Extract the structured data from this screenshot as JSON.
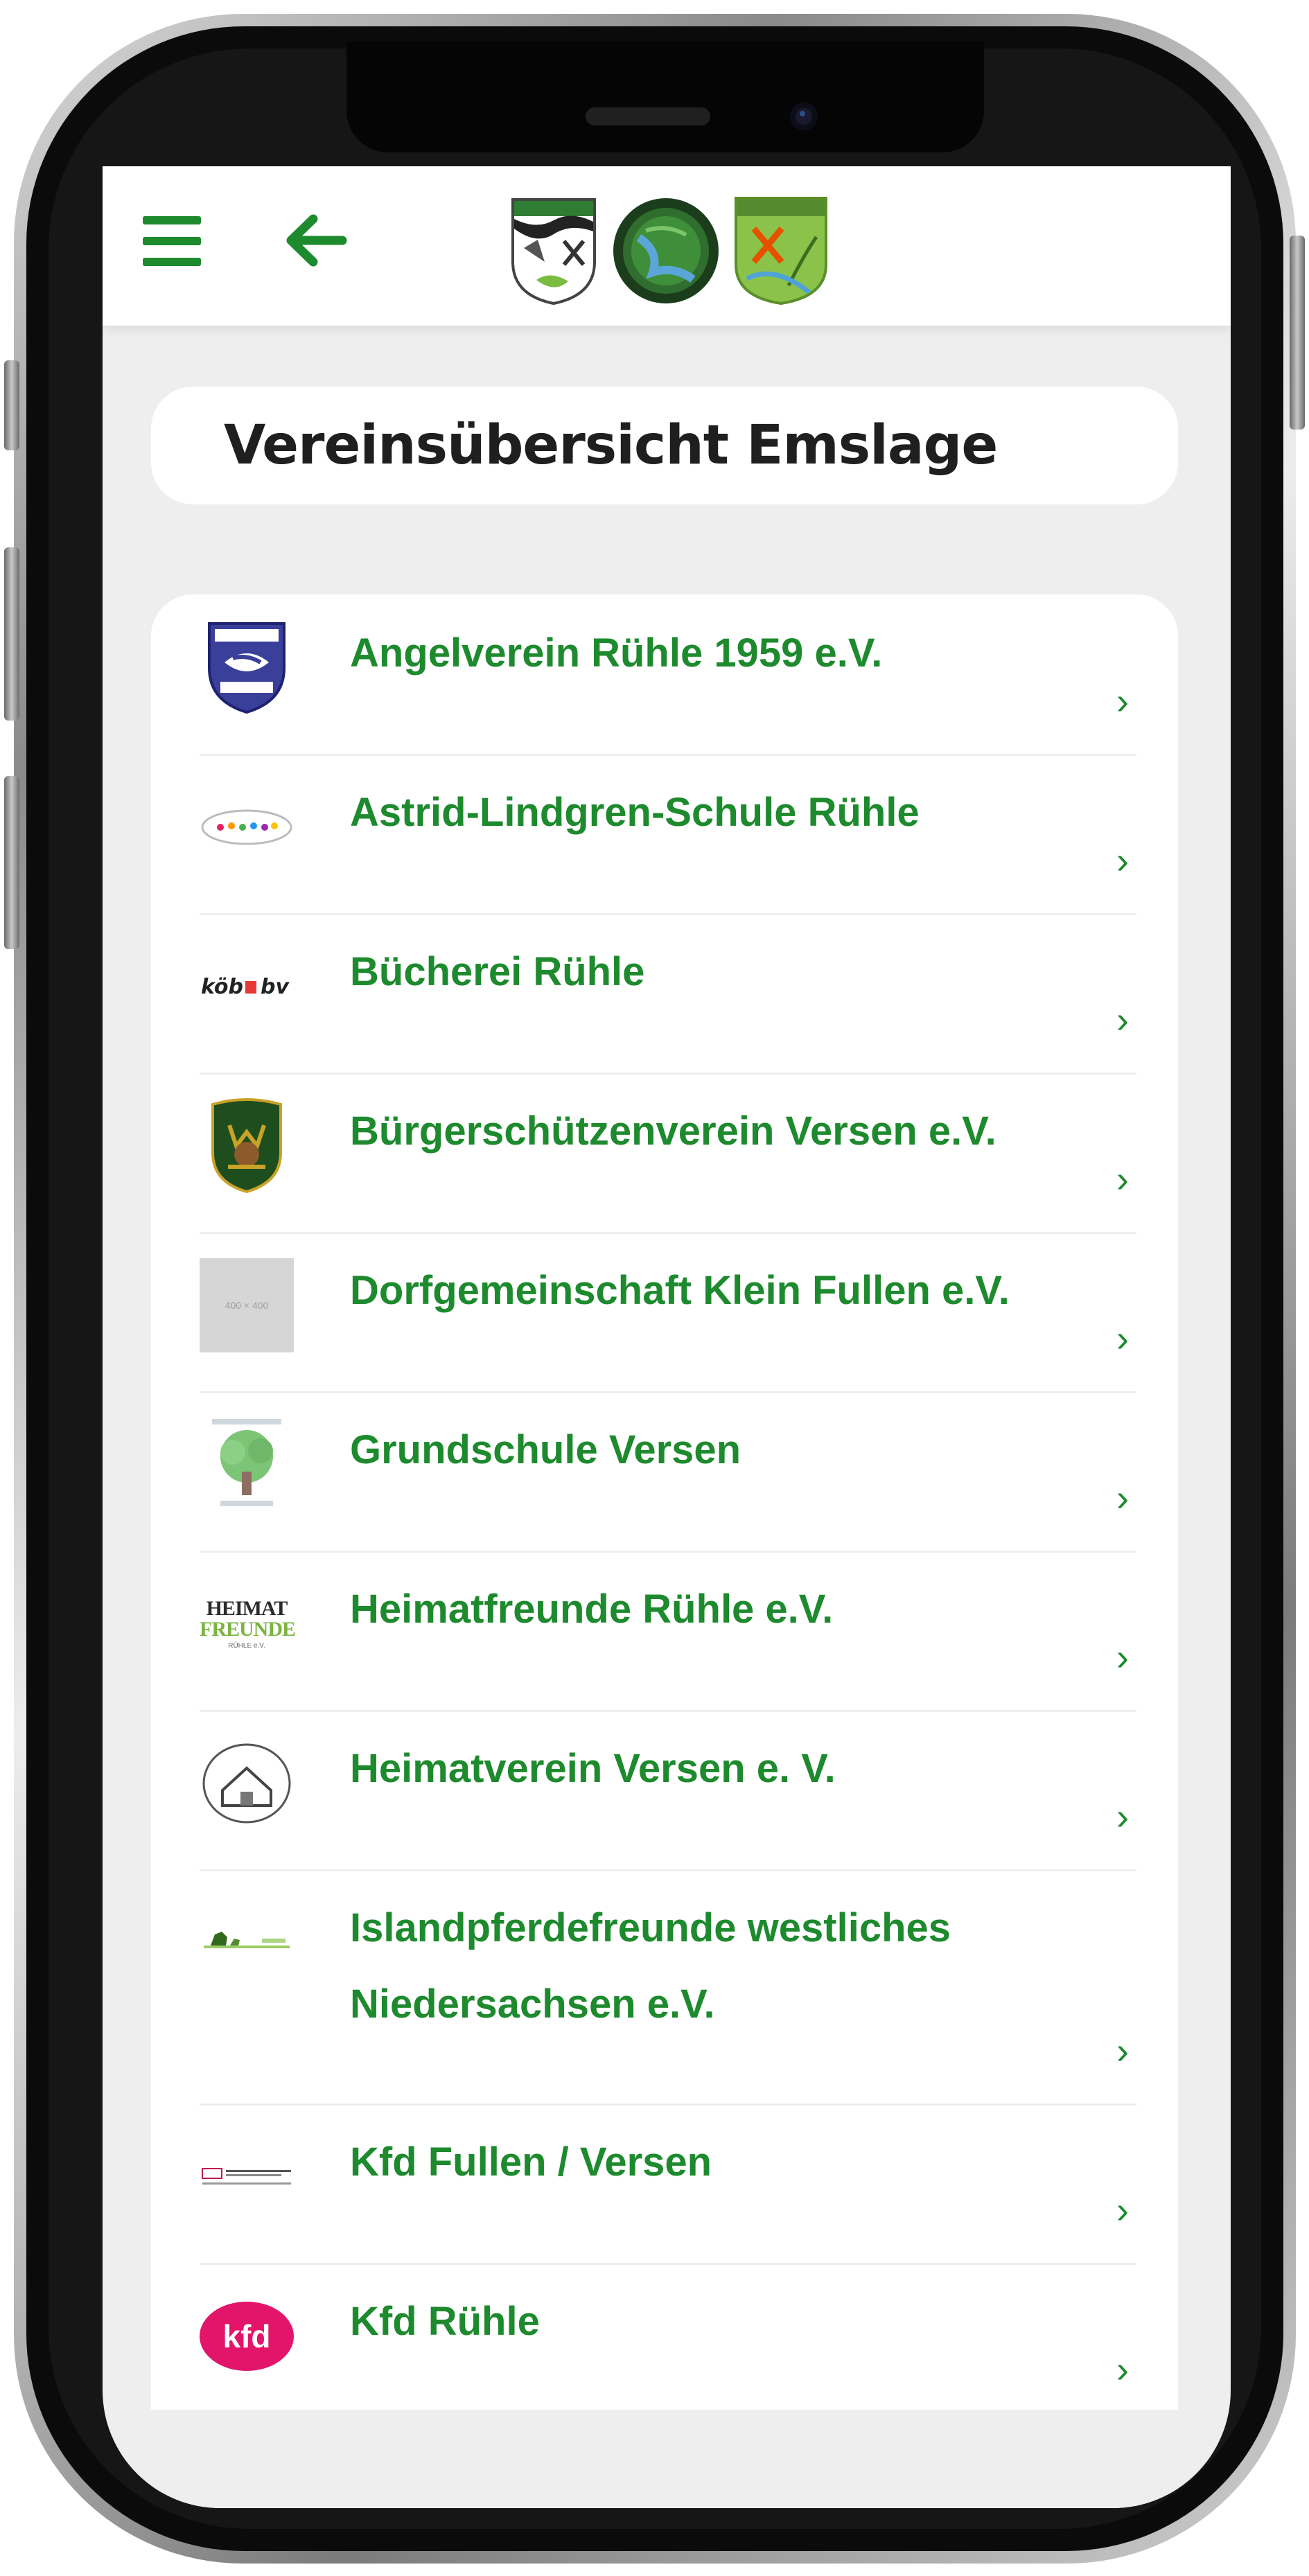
{
  "header": {
    "menu_icon": "hamburger-menu-icon",
    "back_icon": "arrow-left-icon",
    "logos": [
      "village-crest-1",
      "village-crest-2",
      "village-crest-3"
    ]
  },
  "page": {
    "title": "Vereinsübersicht Emslage"
  },
  "clubs": [
    {
      "name": "Angelverein Rühle 1959 e.V.",
      "logo": "angelverein-logo"
    },
    {
      "name": "Astrid-Lindgren-Schule Rühle",
      "logo": "school-logo"
    },
    {
      "name": "Bücherei Rühle",
      "logo": "koeb-bv-logo"
    },
    {
      "name": "Bürgerschützenverein Versen e.V.",
      "logo": "schuetzen-crest"
    },
    {
      "name": "Dorfgemeinschaft Klein Fullen e.V.",
      "logo": "placeholder-image",
      "placeholder_text": "400 × 400"
    },
    {
      "name": "Grundschule Versen",
      "logo": "tree-logo"
    },
    {
      "name": "Heimatfreunde Rühle e.V.",
      "logo": "heimatfreunde-logo",
      "logo_text": [
        "HEIMAT",
        "FREUNDE",
        "RÜHLE e.V."
      ]
    },
    {
      "name": "Heimatverein Versen e. V.",
      "logo": "heimatverein-logo"
    },
    {
      "name": "Islandpferdefreunde westliches Niedersachsen e.V.",
      "logo": "islandpferde-logo"
    },
    {
      "name": "Kfd Fullen / Versen",
      "logo": "kfd-fullen-logo"
    },
    {
      "name": "Kfd Rühle",
      "logo": "kfd-logo",
      "logo_text": "kfd"
    }
  ],
  "chevron": "›",
  "colors": {
    "accent": "#1e8a2e",
    "background": "#eeeeee",
    "card": "#ffffff",
    "title": "#1f1f1f"
  }
}
